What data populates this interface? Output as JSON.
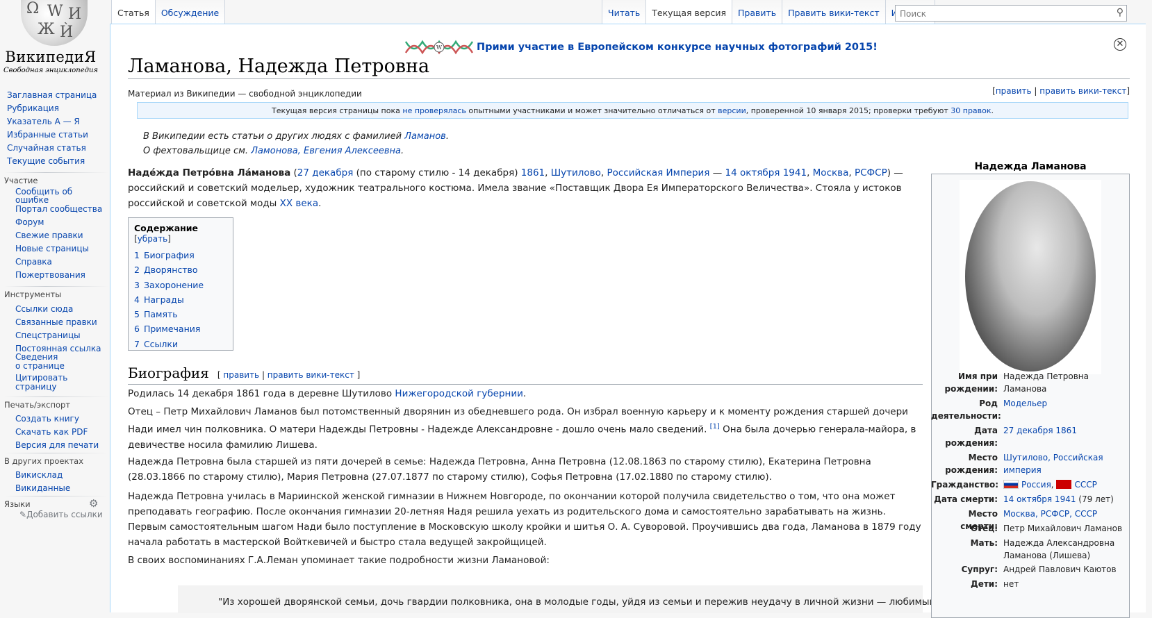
{
  "logo": {
    "wordmark": "ВикипедиЯ",
    "tagline": "Свободная энциклопедия"
  },
  "nav_main": [
    "Заглавная страница",
    "Рубрикация",
    "Указатель А — Я",
    "Избранные статьи",
    "Случайная статья",
    "Текущие события"
  ],
  "portals": {
    "participation": {
      "heading": "Участие",
      "items": [
        "Сообщить об",
        "ошибке",
        "Портал сообщества",
        "Форум",
        "Свежие правки",
        "Новые страницы",
        "Справка",
        "Пожертвования"
      ]
    },
    "tools": {
      "heading": "Инструменты",
      "items": [
        "Ссылки сюда",
        "Связанные правки",
        "Спецстраницы",
        "Постоянная ссылка",
        "Сведения",
        "о странице",
        "Цитировать",
        "страницу"
      ]
    },
    "print": {
      "heading": "Печать/экспорт",
      "items": [
        "Создать книгу",
        "Скачать как PDF",
        "Версия для печати"
      ]
    },
    "projects": {
      "heading": "В других проектах",
      "items": [
        "Викисклад",
        "Викиданные"
      ]
    },
    "languages": {
      "heading": "Языки",
      "add_links": "Добавить ссылки"
    }
  },
  "tabs_left": [
    "Статья",
    "Обсуждение"
  ],
  "tabs_right": [
    "Читать",
    "Текущая версия",
    "Править",
    "Править вики-текст",
    "История"
  ],
  "search": {
    "placeholder": "Поиск"
  },
  "banner": {
    "text": "Прими участие в Европейском конкурсе научных фотографий 2015!"
  },
  "title": "Ламанова, Надежда Петровна",
  "site_sub": "Материал из Википедии — свободной энциклопедии",
  "title_edit": {
    "edit": "править",
    "edit_source": "править вики-текст",
    "sep": "|"
  },
  "review_notice": {
    "a": "Текущая версия страницы пока ",
    "link1": "не проверялась",
    "b": " опытными участниками и может значительно отличаться от ",
    "link2": "версии",
    "c": ", проверенной 10 января 2015; проверки требуют ",
    "link3": "30 правок",
    "d": "."
  },
  "hatnote1": {
    "text": "В Википедии есть статьи о других людях с фамилией ",
    "link": "Ламанов",
    "end": "."
  },
  "hatnote2": {
    "text": "О фехтовальщице см. ",
    "link": "Ламонова, Евгения Алексеевна",
    "end": "."
  },
  "lead": {
    "bold": "Наде́жда Петро́вна Ла́манова",
    "l1": "27 декабря",
    "t1": " (по старому стилю - 14 декабря) ",
    "l2": "1861",
    "l3": "Шутилово",
    "l4": "Российская Империя",
    "dash": " — ",
    "l5": "14 октября",
    "l6": "1941",
    "l7": "Москва",
    "l8": "РСФСР",
    "t2": ") — российский и советский модельер, художник театрального костюма. Имела звание «Поставщик Двора Ея Императорского Величества». Стояла у истоков российской и советской моды ",
    "l9": "XX века",
    "t3": "."
  },
  "toc": {
    "heading": "Содержание",
    "toggle": "убрать",
    "entries": [
      {
        "num": "1",
        "label": "Биография"
      },
      {
        "num": "2",
        "label": "Дворянство"
      },
      {
        "num": "3",
        "label": "Захоронение"
      },
      {
        "num": "4",
        "label": "Награды"
      },
      {
        "num": "5",
        "label": "Память"
      },
      {
        "num": "6",
        "label": "Примечания"
      },
      {
        "num": "7",
        "label": "Ссылки"
      }
    ]
  },
  "section": {
    "title": "Биография",
    "edit": "править",
    "edit_source": "править вики-текст"
  },
  "body": {
    "p1a": "Родилась 14 декабря 1861 года в деревне Шутилово ",
    "p1link": "Нижегородской губернии",
    "p1b": ".",
    "p2a": "Отец – Петр Михайлович Ламанов был потомственный дворянин из обедневшего рода. Он избрал военную карьеру и к моменту рождения старшей дочери Нади имел чин полковника. О матери Надежды Петровны - Надежде Александровне - дошло очень мало сведений. ",
    "p2ref": "[1]",
    "p2b": " Она была дочерью генерала-майора, в девичестве носила фамилию Лишева.",
    "p3": "Надежда Петровна была старшей из пяти дочерей в семье: Надежда Петровна, Анна Петровна (12.08.1863 по старому стилю), Екатерина Петровна (28.03.1866 по старому стилю), Мария Петровна (27.07.1877 по старому стилю), Софья Петровна (17.02.1880 по старому стилю).",
    "p4": "Надежда Петровна училась в Мариинской женской гимназии в Нижнем Новгороде, по окончании которой получила свидетельство о том, что она может преподавать географию. После окончания гимназии 20-летняя Надя решила уехать из родительского дома и самостоятельно зарабатывать на жизнь. Первым самостоятельным шагом Нади было поступление в Московскую школу кройки и шитья О. А. Суворовой. Проучившись два года, Ламанова в 1879 году начала работать в мастерской Войткевичей и быстро стала ведущей закройщицей.",
    "p5": "В своих воспоминаниях Г.А.Леман упоминает такие подробности жизни Ламановой:",
    "quote": "\"Из хорошей дворянской семьи, дочь гвардии полковника, она в молодые годы, уйдя из семьи и пережив неудачу в личной жизни — любимый человек,"
  },
  "infobox": {
    "title": "Надежда Ламанова",
    "rows": [
      {
        "label": [
          "Имя при",
          "рождении:"
        ],
        "value": [
          "Надежда Петровна",
          "Ламанова"
        ]
      },
      {
        "label": [
          "Род",
          "деятельности:"
        ],
        "value_link": "Модельер"
      },
      {
        "label": [
          "Дата",
          "рождения:"
        ],
        "value_link": "27 декабря 1861"
      },
      {
        "label": [
          "Место",
          "рождения:"
        ],
        "value_links": [
          "Шутилово, Российская",
          "империя"
        ]
      },
      {
        "label": [
          "Гражданство:"
        ],
        "flags": [
          {
            "name": "Россия",
            "color": "#ffffff"
          },
          {
            "name": "СССР",
            "color": "#cc0000"
          }
        ]
      },
      {
        "label": [
          "Дата смерти:"
        ],
        "value_link": "14 октября 1941",
        "value_suffix": " (79 лет)"
      },
      {
        "label": [
          "Место смерти:"
        ],
        "value_link": "Москва, РСФСР, СССР"
      },
      {
        "label": [
          "Отец:"
        ],
        "value": [
          "Петр Михайлович Ламанов"
        ]
      },
      {
        "label": [
          "Мать:"
        ],
        "value": [
          "Надежда Александровна",
          "Ламанова (Лишева)"
        ]
      },
      {
        "label": [
          "Супруг:"
        ],
        "value": [
          "Андрей Павлович Каютов"
        ]
      },
      {
        "label": [
          "Дети:"
        ],
        "value": [
          "нет"
        ]
      }
    ]
  },
  "colors": {
    "link": "#0645ad",
    "border": "#a2a9b1",
    "tab_border": "#a7d7f9",
    "review_bg": "#eef5fd"
  },
  "icons": {
    "search": "search-icon",
    "close": "close-icon",
    "gear": "gear-icon",
    "pencil": "pencil-icon"
  }
}
